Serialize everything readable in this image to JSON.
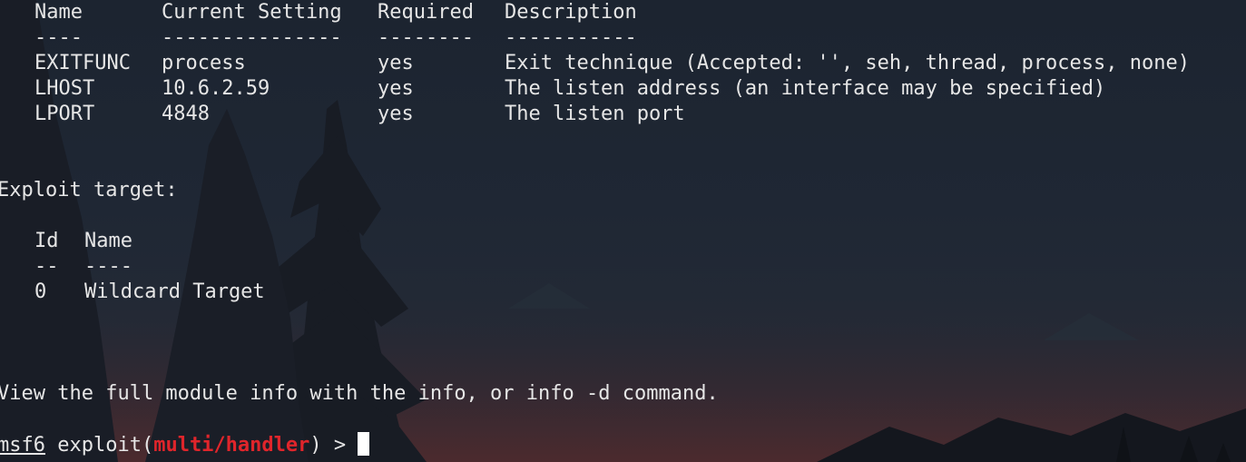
{
  "options_table": {
    "headers": {
      "name": "Name",
      "current": "Current Setting",
      "required": "Required",
      "description": "Description"
    },
    "dashes": {
      "name": "----",
      "current": "---------------",
      "required": "--------",
      "description": "-----------"
    },
    "rows": [
      {
        "name": "EXITFUNC",
        "current": "process",
        "required": "yes",
        "description": "Exit technique (Accepted: '', seh, thread, process, none)"
      },
      {
        "name": "LHOST",
        "current": "10.6.2.59",
        "required": "yes",
        "description": "The listen address (an interface may be specified)"
      },
      {
        "name": "LPORT",
        "current": "4848",
        "required": "yes",
        "description": "The listen port"
      }
    ]
  },
  "exploit_target": {
    "heading": "Exploit target:",
    "headers": {
      "id": "Id",
      "name": "Name"
    },
    "dashes": {
      "id": "--",
      "name": "----"
    },
    "rows": [
      {
        "id": "0",
        "name": "Wildcard Target"
      }
    ]
  },
  "info_message": "View the full module info with the info, or info -d command.",
  "prompt": {
    "prefix": "msf6",
    "middle": " exploit(",
    "module": "multi/handler",
    "suffix": ") > "
  },
  "colors": {
    "text": "#e6e6e6",
    "module_red": "#e0252b",
    "cursor": "#ffffff"
  }
}
